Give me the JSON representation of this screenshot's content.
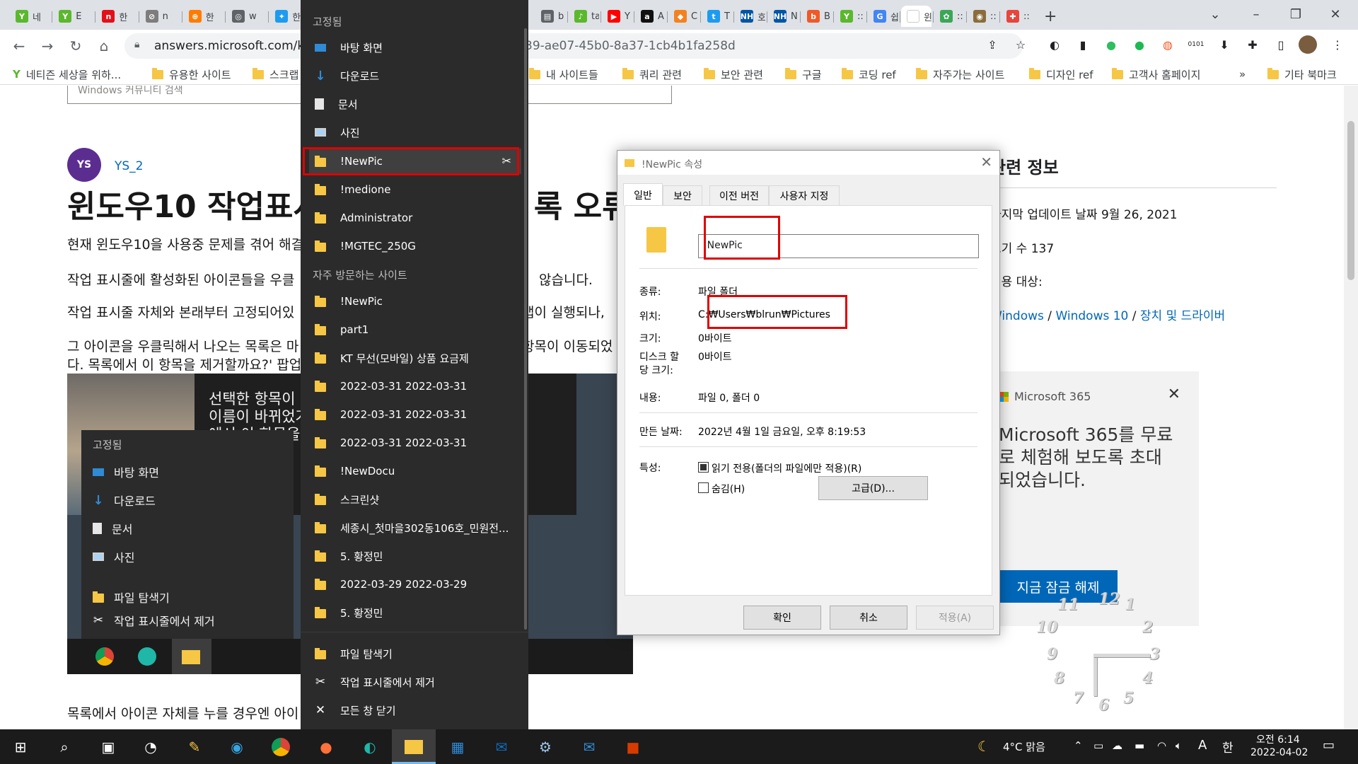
{
  "browser": {
    "tabs": [
      {
        "label": "네",
        "fav_color": "#5bb82d",
        "fav_glyph": "Y"
      },
      {
        "label": "E",
        "fav_color": "#5bb82d",
        "fav_glyph": "Y"
      },
      {
        "label": "한",
        "fav_color": "#e3101a",
        "fav_glyph": "n"
      },
      {
        "label": "n",
        "fav_color": "#7d7d7d",
        "fav_glyph": "⊘"
      },
      {
        "label": "한",
        "fav_color": "#ff7b00",
        "fav_glyph": "⊕"
      },
      {
        "label": "w",
        "fav_color": "#5f6368",
        "fav_glyph": "◎"
      },
      {
        "label": "한",
        "fav_color": "#1d9bf0",
        "fav_glyph": "✦"
      },
      {
        "label": "b",
        "fav_color": "#5f6368",
        "fav_glyph": "▤"
      },
      {
        "label": "ta",
        "fav_color": "#5bb82d",
        "fav_glyph": "♪"
      },
      {
        "label": "Y",
        "fav_color": "#ff0000",
        "fav_glyph": "▶"
      },
      {
        "label": "A",
        "fav_color": "#111111",
        "fav_glyph": "a"
      },
      {
        "label": "C",
        "fav_color": "#f48120",
        "fav_glyph": "◆"
      },
      {
        "label": "T",
        "fav_color": "#1d9bf0",
        "fav_glyph": "t"
      },
      {
        "label": "호",
        "fav_color": "#0055a5",
        "fav_glyph": "NH"
      },
      {
        "label": "N",
        "fav_color": "#0055a5",
        "fav_glyph": "NH"
      },
      {
        "label": "B",
        "fav_color": "#f05a28",
        "fav_glyph": "b"
      },
      {
        "label": "::",
        "fav_color": "#5bb82d",
        "fav_glyph": "Y"
      },
      {
        "label": "쉽",
        "fav_color": "#4285f4",
        "fav_glyph": "G"
      },
      {
        "label": "윈",
        "fav_color": "#ffffff",
        "fav_glyph": ""
      },
      {
        "label": "::",
        "fav_color": "#3aa757",
        "fav_glyph": "✿"
      },
      {
        "label": "::",
        "fav_color": "#8a6d3b",
        "fav_glyph": "◉"
      },
      {
        "label": "::",
        "fav_color": "#e8453c",
        "fav_glyph": "✚"
      }
    ],
    "new_tab": "+",
    "url_host": "answers.microsoft.com/ko-",
    "url_tail": "39-ae07-45b0-8a37-1cb4b1fa258d",
    "bookmarks": [
      {
        "label": "네티즌 세상을 위하..."
      },
      {
        "label": "유용한 사이트"
      },
      {
        "label": "스크랩"
      },
      {
        "label": "내 사이트들"
      },
      {
        "label": "쿼리 관련"
      },
      {
        "label": "보안 관련"
      },
      {
        "label": "구글"
      },
      {
        "label": "코딩 ref"
      },
      {
        "label": "자주가는 사이트"
      },
      {
        "label": "디자인 ref"
      },
      {
        "label": "고객사 홈페이지"
      }
    ],
    "bookmarks_more": "»",
    "bookmarks_other": "기타 북마크"
  },
  "article": {
    "search_placeholder": "Windows 커뮤니티 검색",
    "avatar_initials": "YS",
    "author": "YS_2",
    "title": "윈도우10 작업표시",
    "title_tail": "록 오류",
    "p1": "현재 윈도우10을 사용중 문제를 겪어 해결",
    "p2a": "작업 표시줄에 활성화된 아이콘들을 우클",
    "p2b": "않습니다.",
    "p3a": "작업 표시줄 자체와 본래부터 고정되어있",
    "p3b": "앱이 실행되나,",
    "p4a": "그 아이콘을 우클릭해서 나오는 목록은 마",
    "p4b": "항목이 이동되었",
    "p5a": "다. 목록에서 이 항목을 제거할까요?' 팝업",
    "bottom": "목록에서 아이콘 자체를 누를 경우엔 아이"
  },
  "embedded_image": {
    "tooltip_lines": [
      "선택한 항목이 이",
      "이름이 바뀌었거",
      "에서 이 항목을"
    ],
    "tooltip_item": "문서",
    "menu_head": "고정됨",
    "menu_items": [
      "바탕 화면",
      "다운로드",
      "문서",
      "사진"
    ],
    "menu_bottom": [
      "파일 탐색기",
      "작업 표시줄에서 제거"
    ]
  },
  "right_column": {
    "title": "관련 정보",
    "updated": "마지막 업데이트 날짜 9월 26, 2021",
    "views": "보기 수 137",
    "applies": "적용 대상:",
    "crumb1": "Windows",
    "crumb2": "Windows 10",
    "crumb3": "장치 및 드라이버",
    "crumb_sep": "/",
    "ad_brand": "Microsoft 365",
    "ad_line1": "Microsoft 365를 무료",
    "ad_line2": "로 체험해 보도록 초대",
    "ad_line3": "되었습니다.",
    "ad_button": "지금 잠금 해제",
    "ad_close": "✕"
  },
  "clock_numbers": [
    "12",
    "1",
    "2",
    "3",
    "4",
    "5",
    "6",
    "7",
    "8",
    "9",
    "10",
    "11"
  ],
  "jumplist": {
    "pinned_head": "고정됨",
    "pinned": [
      {
        "label": "바탕 화면",
        "icon": "desktop-icon"
      },
      {
        "label": "다운로드",
        "icon": "download-icon"
      },
      {
        "label": "문서",
        "icon": "document-icon"
      },
      {
        "label": "사진",
        "icon": "pictures-icon"
      },
      {
        "label": "!NewPic",
        "icon": "folder-icon"
      },
      {
        "label": "!medione",
        "icon": "folder-icon"
      },
      {
        "label": "Administrator",
        "icon": "folder-icon"
      },
      {
        "label": "!MGTEC_250G",
        "icon": "folder-icon"
      }
    ],
    "frequent_head": "자주 방문하는 사이트",
    "frequent": [
      {
        "label": "!NewPic"
      },
      {
        "label": "part1"
      },
      {
        "label": "KT 무선(모바일) 상품 요금제"
      },
      {
        "label": "2022-03-31 2022-03-31"
      },
      {
        "label": "2022-03-31 2022-03-31"
      },
      {
        "label": "2022-03-31 2022-03-31"
      },
      {
        "label": "!NewDocu"
      },
      {
        "label": "스크린샷"
      },
      {
        "label": "세종시_첫마을302동106호_민원전..."
      },
      {
        "label": "5. 황정민"
      },
      {
        "label": "2022-03-29 2022-03-29"
      },
      {
        "label": "5. 황정민"
      }
    ],
    "actions": [
      {
        "label": "파일 탐색기"
      },
      {
        "label": "작업 표시줄에서 제거"
      },
      {
        "label": "모든 창 닫기"
      }
    ]
  },
  "dialog": {
    "title": "!NewPic 속성",
    "tabs": [
      "일반",
      "보안",
      "이전 버전",
      "사용자 지정"
    ],
    "name_value": "!NewPic",
    "type_label": "종류:",
    "type_value": "파일 폴더",
    "location_label": "위치:",
    "location_value": "C:₩Users₩blrun₩Pictures",
    "size_label": "크기:",
    "size_value": "0바이트",
    "disk_label_1": "디스크 할",
    "disk_label_2": "당 크기:",
    "disk_value": "0바이트",
    "contents_label": "내용:",
    "contents_value": "파일 0, 폴더 0",
    "created_label": "만든 날짜:",
    "created_value": "2022년 4월 1일 금요일, 오후 8:19:53",
    "attributes_label": "특성:",
    "readonly_label": "읽기 전용(폴더의 파일에만 적용)(R)",
    "hidden_label": "숨김(H)",
    "advanced_button": "고급(D)...",
    "ok_button": "확인",
    "cancel_button": "취소",
    "apply_button": "적용(A)",
    "close": "✕"
  },
  "taskbar": {
    "weather": "4°C 맑음",
    "ime_a": "A",
    "ime_han": "한",
    "time_ampm": "오전 6:14",
    "date": "2022-04-02"
  }
}
